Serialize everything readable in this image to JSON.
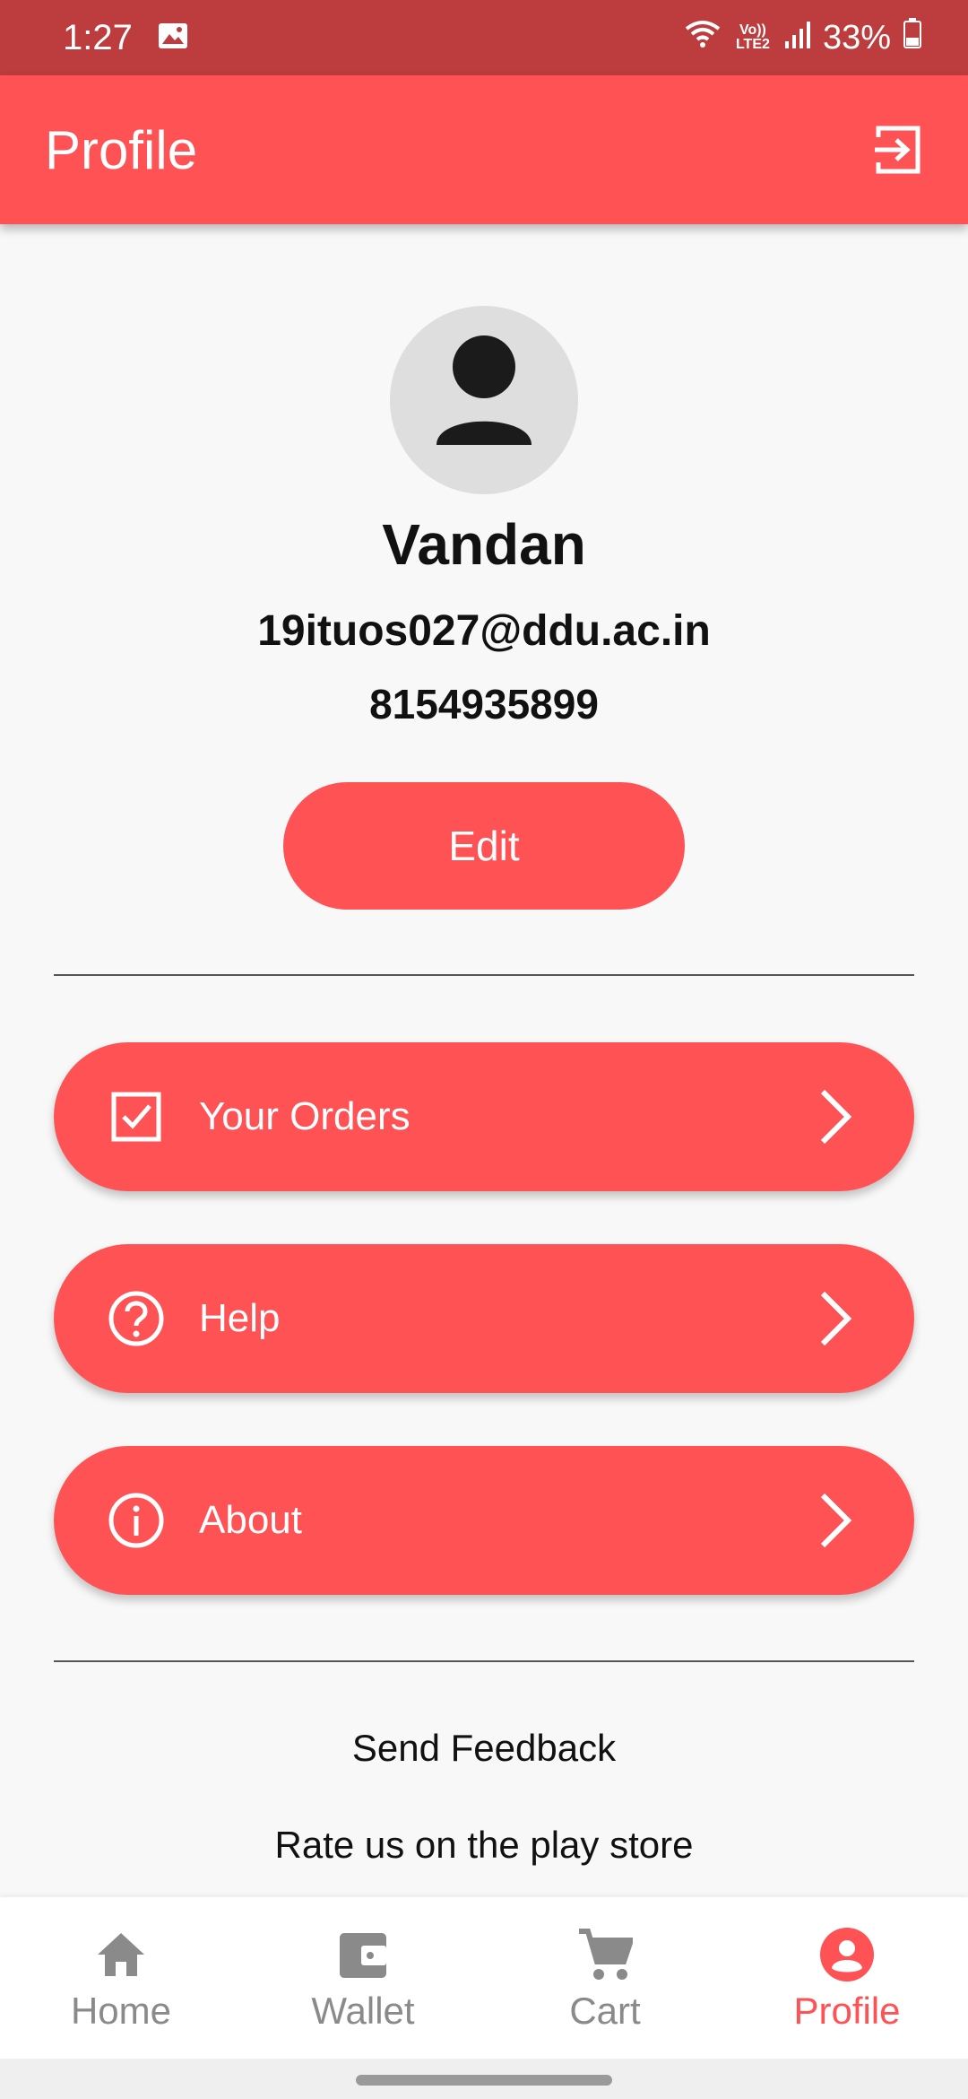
{
  "status_bar": {
    "time": "1:27",
    "network": "Vo)) LTE2",
    "battery": "33%"
  },
  "app_bar": {
    "title": "Profile",
    "logout_icon": "logout-icon"
  },
  "profile": {
    "name": "Vandan",
    "email": "19ituos027@ddu.ac.in",
    "phone": "8154935899",
    "edit_label": "Edit"
  },
  "menu": [
    {
      "label": "Your Orders",
      "icon": "checkbox-icon"
    },
    {
      "label": "Help",
      "icon": "help-icon"
    },
    {
      "label": "About",
      "icon": "info-icon"
    }
  ],
  "links": {
    "feedback": "Send Feedback",
    "rate": "Rate us on the play store"
  },
  "bottom_nav": {
    "items": [
      {
        "label": "Home",
        "icon": "home-icon",
        "active": false
      },
      {
        "label": "Wallet",
        "icon": "wallet-icon",
        "active": false
      },
      {
        "label": "Cart",
        "icon": "cart-icon",
        "active": false
      },
      {
        "label": "Profile",
        "icon": "profile-icon",
        "active": true
      }
    ]
  },
  "colors": {
    "accent": "#fe5254",
    "status_bar": "#bd3c3d",
    "inactive_nav": "#8a8a8a",
    "background": "#f8f8f8"
  }
}
